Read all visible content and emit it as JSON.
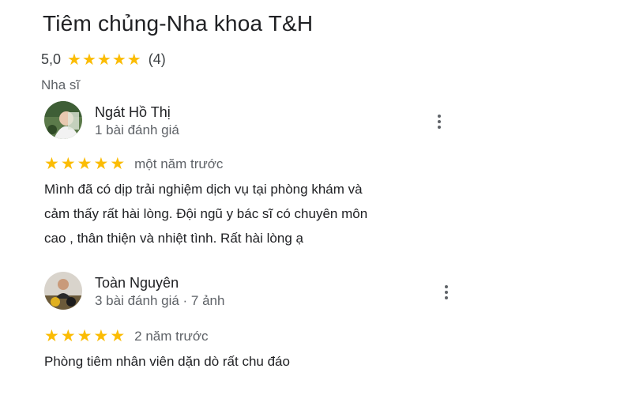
{
  "place": {
    "title": "Tiêm chủng-Nha khoa T&H",
    "rating": "5,0",
    "stars": 5,
    "review_count": "(4)",
    "category": "Nha sĩ",
    "star_color": "#fbbc04"
  },
  "reviews": [
    {
      "name": "Ngát Hồ Thị",
      "meta": "1 bài đánh giá",
      "stars": 5,
      "time": "một năm trước",
      "text_lines": [
        "Mình đã có dịp trải nghiệm dịch vụ tại phòng khám và",
        "cảm thấy rất hài lòng. Đội ngũ y bác sĩ có chuyên môn",
        "cao , thân thiện và nhiệt tình. Rất hài lòng ạ"
      ],
      "more_icon": "more-vert-icon"
    },
    {
      "name": "Toàn Nguyên",
      "meta": "3 bài đánh giá · 7 ảnh",
      "stars": 5,
      "time": "2 năm trước",
      "text_lines": [
        "Phòng tiêm nhân viên dặn dò rất chu đáo"
      ],
      "more_icon": "more-vert-icon"
    }
  ]
}
